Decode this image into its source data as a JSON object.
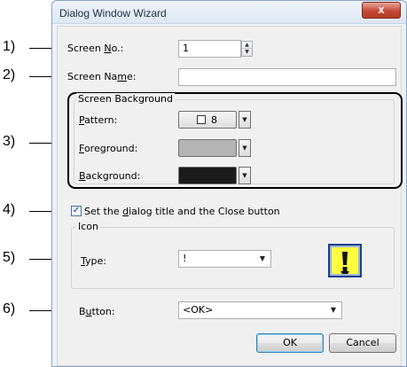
{
  "callouts": [
    "1)",
    "2)",
    "3)",
    "4)",
    "5)",
    "6)"
  ],
  "window": {
    "title": "Dialog Window Wizard",
    "close_glyph": "x"
  },
  "screen_no": {
    "label_pre": "Screen ",
    "label_key": "N",
    "label_post": "o.:",
    "value": "1"
  },
  "screen_name": {
    "label_pre": "Screen Na",
    "label_key": "m",
    "label_post": "e:",
    "value": ""
  },
  "screen_background": {
    "group_label": "Screen Background",
    "pattern": {
      "label_key": "P",
      "label_post": "attern:",
      "value": "8"
    },
    "foreground": {
      "label_key": "F",
      "label_post": "oreground:",
      "color": "#b4b4b4"
    },
    "background": {
      "label_key": "B",
      "label_post": "ackground:",
      "color": "#1c1c1c"
    }
  },
  "dialog_title_check": {
    "checked": true,
    "label_pre": "Set the ",
    "label_key": "d",
    "label_post": "ialog title and the Close button"
  },
  "icon": {
    "group_label": "Icon",
    "type": {
      "label_key": "T",
      "label_post": "ype:",
      "value": "!"
    },
    "preview_icon": "exclamation-icon"
  },
  "button": {
    "label_pre": "B",
    "label_key": "u",
    "label_post": "tton:",
    "value": "<OK>"
  },
  "actions": {
    "ok": "OK",
    "cancel": "Cancel"
  },
  "colors": {
    "callout_outline": "#000000",
    "icon_bg": "#ffff40",
    "icon_frame": "#1c3f8f"
  }
}
